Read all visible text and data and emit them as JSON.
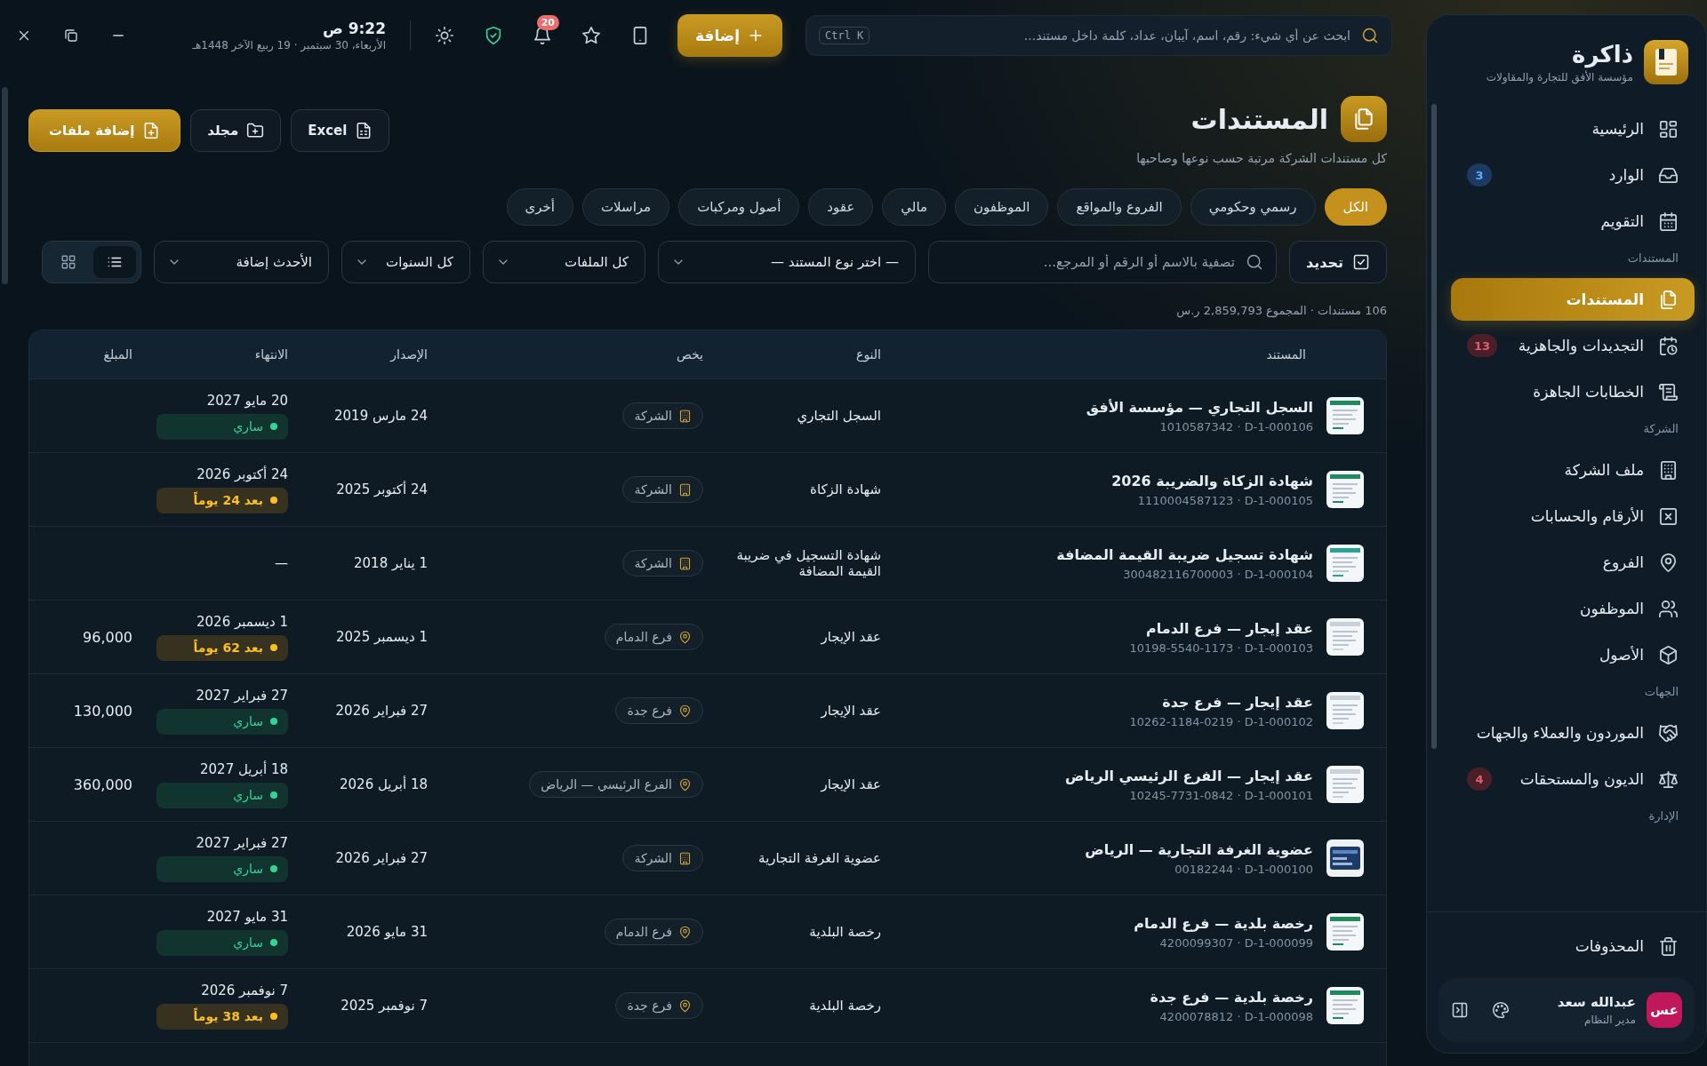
{
  "topbar": {
    "search_placeholder": "ابحث عن أي شيء: رقم، اسم، آيبان، عداد، كلمة داخل مستند...",
    "shortcut": "Ctrl K",
    "add_label": "إضافة",
    "notifications": "20",
    "time": "9:22 ص",
    "date": "الأربعاء، 30 سبتمبر · 19 ربيع الآخر 1448هـ"
  },
  "sidebar": {
    "brand": {
      "name": "ذاكرة",
      "subtitle": "مؤسسة الأفق للتجارة والمقاولات"
    },
    "nav": [
      {
        "kind": "link",
        "label": "الرئيسية",
        "selected": false
      },
      {
        "kind": "link",
        "label": "الوارد",
        "selected": false,
        "badge": "3",
        "color": "#1d3a63"
      },
      {
        "kind": "link",
        "label": "التقويم",
        "selected": false
      },
      {
        "kind": "section",
        "label": "المستندات"
      },
      {
        "kind": "link",
        "label": "المستندات",
        "selected": true
      },
      {
        "kind": "link",
        "label": "التجديدات والجاهزية",
        "selected": false,
        "badge": "13",
        "color": "#4b1f27"
      },
      {
        "kind": "link",
        "label": "الخطابات الجاهزة",
        "selected": false
      },
      {
        "kind": "section",
        "label": "الشركة"
      },
      {
        "kind": "link",
        "label": "ملف الشركة",
        "selected": false
      },
      {
        "kind": "link",
        "label": "الأرقام والحسابات",
        "selected": false
      },
      {
        "kind": "link",
        "label": "الفروع",
        "selected": false
      },
      {
        "kind": "link",
        "label": "الموظفون",
        "selected": false
      },
      {
        "kind": "link",
        "label": "الأصول",
        "selected": false
      },
      {
        "kind": "section",
        "label": "الجهات"
      },
      {
        "kind": "link",
        "label": "الموردون والعملاء والجهات",
        "selected": false
      },
      {
        "kind": "link",
        "label": "الديون والمستحقات",
        "selected": false,
        "badge": "4",
        "color": "#4b1f27"
      },
      {
        "kind": "section",
        "label": "الإدارة"
      }
    ],
    "trash": "المحذوفات",
    "user": {
      "initials": "عس",
      "name": "عبدالله سعد",
      "role": "مدير النظام"
    }
  },
  "page": {
    "title": "المستندات",
    "subtitle": "كل مستندات الشركة مرتبة حسب نوعها وصاحبها",
    "actions": [
      {
        "label": "Excel",
        "kind": "excel"
      },
      {
        "label": "مجلد",
        "kind": "folder"
      },
      {
        "label": "إضافة ملفات",
        "kind": "add-files"
      }
    ]
  },
  "tabs": [
    {
      "label": "الكل",
      "selected": true
    },
    {
      "label": "رسمي وحكومي",
      "selected": false
    },
    {
      "label": "الفروع والمواقع",
      "selected": false
    },
    {
      "label": "الموظفون",
      "selected": false
    },
    {
      "label": "مالي",
      "selected": false
    },
    {
      "label": "عقود",
      "selected": false
    },
    {
      "label": "أصول ومركبات",
      "selected": false
    },
    {
      "label": "مراسلات",
      "selected": false
    },
    {
      "label": "أخرى",
      "selected": false
    }
  ],
  "filters": {
    "refresh": "تحديد",
    "search_placeholder": "تصفية بالاسم أو الرقم أو المرجع...",
    "selects": [
      "— اختر نوع المستند —",
      "كل الملفات",
      "كل السنوات",
      "الأحدث إضافة"
    ],
    "views": [
      {
        "kind": "list",
        "selected": true
      },
      {
        "kind": "grid",
        "selected": false
      }
    ]
  },
  "summary": "106 مستندات · المجموع 2,859,793 ر.س",
  "table": {
    "columns": [
      "المستند",
      "النوع",
      "يخص",
      "الإصدار",
      "الانتهاء",
      "المبلغ"
    ],
    "rows": [
      {
        "title": "السجل التجاري — مؤسسة الأفق",
        "reference": "1010587342 · D-1-000106",
        "type": "السجل التجاري",
        "owner": {
          "kind": "company",
          "label": "الشركة"
        },
        "issued": "24 مارس 2019",
        "expires": "20 مايو 2027",
        "status": {
          "kind": "active",
          "label": "ساري"
        }
      },
      {
        "title": "شهادة الزكاة والضريبة 2026",
        "reference": "1110004587123 · D-1-000105",
        "type": "شهادة الزكاة",
        "owner": {
          "kind": "company",
          "label": "الشركة"
        },
        "issued": "24 أكتوبر 2025",
        "expires": "24 أكتوبر 2026",
        "status": {
          "kind": "due",
          "label": "بعد 24 يوماً"
        }
      },
      {
        "title": "شهادة تسجيل ضريبة القيمة المضافة",
        "reference": "300482116700003 · D-1-000104",
        "type": "شهادة التسجيل في ضريبة القيمة المضافة",
        "owner": {
          "kind": "company",
          "label": "الشركة"
        },
        "issued": "1 يناير 2018",
        "expires": "—"
      },
      {
        "title": "عقد إيجار — فرع الدمام",
        "reference": "10198-5540-1173 · D-1-000103",
        "type": "عقد الإيجار",
        "owner": {
          "kind": "branch",
          "label": "فرع الدمام"
        },
        "issued": "1 ديسمبر 2025",
        "expires": "1 ديسمبر 2026",
        "status": {
          "kind": "due",
          "label": "بعد 62 يوماً"
        },
        "amount": "96,000"
      },
      {
        "title": "عقد إيجار — فرع جدة",
        "reference": "10262-1184-0219 · D-1-000102",
        "type": "عقد الإيجار",
        "owner": {
          "kind": "branch",
          "label": "فرع جدة"
        },
        "issued": "27 فبراير 2026",
        "expires": "27 فبراير 2027",
        "status": {
          "kind": "active",
          "label": "ساري"
        },
        "amount": "130,000"
      },
      {
        "title": "عقد إيجار — الفرع الرئيسي الرياض",
        "reference": "10245-7731-0842 · D-1-000101",
        "type": "عقد الإيجار",
        "owner": {
          "kind": "branch",
          "label": "الفرع الرئيسي — الرياض"
        },
        "issued": "18 أبريل 2026",
        "expires": "18 أبريل 2027",
        "status": {
          "kind": "active",
          "label": "ساري"
        },
        "amount": "360,000"
      },
      {
        "title": "عضوية الغرفة التجارية — الرياض",
        "reference": "00182244 · D-1-000100",
        "type": "عضوية الغرفة التجارية",
        "owner": {
          "kind": "company",
          "label": "الشركة"
        },
        "issued": "27 فبراير 2026",
        "expires": "27 فبراير 2027",
        "status": {
          "kind": "active",
          "label": "ساري"
        }
      },
      {
        "title": "رخصة بلدية — فرع الدمام",
        "reference": "4200099307 · D-1-000099",
        "type": "رخصة البلدية",
        "owner": {
          "kind": "branch",
          "label": "فرع الدمام"
        },
        "issued": "31 مايو 2026",
        "expires": "31 مايو 2027",
        "status": {
          "kind": "active",
          "label": "ساري"
        }
      },
      {
        "title": "رخصة بلدية — فرع جدة",
        "reference": "4200078812 · D-1-000098",
        "type": "رخصة البلدية",
        "owner": {
          "kind": "branch",
          "label": "فرع جدة"
        },
        "issued": "7 نوفمبر 2025",
        "expires": "7 نوفمبر 2026",
        "status": {
          "kind": "due",
          "label": "بعد 38 يوماً"
        }
      }
    ]
  }
}
